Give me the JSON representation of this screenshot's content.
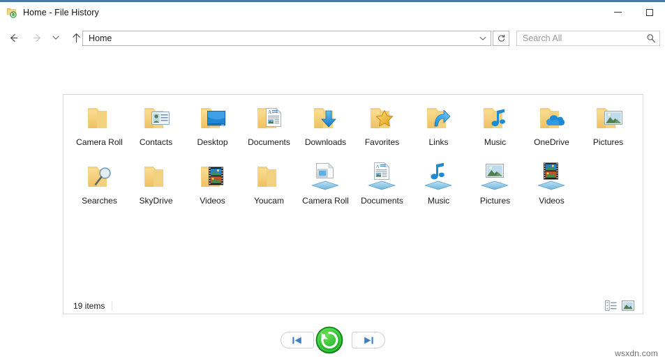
{
  "window": {
    "title": "Home - File History",
    "title_icon": "file-history-folder-icon",
    "accent_color": "#4a7aa7",
    "buttons": [
      {
        "name": "minimize-button",
        "glyph": "minimize-icon",
        "label": "Minimize"
      },
      {
        "name": "maximize-button",
        "glyph": "maximize-icon",
        "label": "Maximize"
      }
    ]
  },
  "navbar": {
    "back": {
      "icon": "arrow-left-icon",
      "label": "Back",
      "enabled": true
    },
    "forward": {
      "icon": "arrow-right-icon",
      "label": "Forward",
      "enabled": false
    },
    "recent": {
      "icon": "chevron-down-icon",
      "label": "Recent locations"
    },
    "up": {
      "icon": "arrow-up-icon",
      "label": "Up"
    },
    "address": {
      "value": "Home",
      "dropdown_icon": "chevron-down-icon"
    },
    "refresh": {
      "icon": "refresh-icon",
      "label": "Refresh"
    },
    "search": {
      "placeholder": "Search All",
      "value": "",
      "icon": "search-icon"
    }
  },
  "content": {
    "items": [
      {
        "label": "Camera Roll",
        "icon": "folder-plain-icon",
        "kind": "folder"
      },
      {
        "label": "Contacts",
        "icon": "folder-contacts-icon",
        "kind": "folder"
      },
      {
        "label": "Desktop",
        "icon": "folder-desktop-icon",
        "kind": "folder"
      },
      {
        "label": "Documents",
        "icon": "folder-documents-icon",
        "kind": "folder"
      },
      {
        "label": "Downloads",
        "icon": "folder-downloads-icon",
        "kind": "folder"
      },
      {
        "label": "Favorites",
        "icon": "folder-favorites-icon",
        "kind": "folder"
      },
      {
        "label": "Links",
        "icon": "folder-links-icon",
        "kind": "folder"
      },
      {
        "label": "Music",
        "icon": "folder-music-icon",
        "kind": "folder"
      },
      {
        "label": "OneDrive",
        "icon": "folder-onedrive-icon",
        "kind": "folder"
      },
      {
        "label": "Pictures",
        "icon": "folder-pictures-icon",
        "kind": "folder"
      },
      {
        "label": "Searches",
        "icon": "folder-searches-icon",
        "kind": "folder"
      },
      {
        "label": "SkyDrive",
        "icon": "folder-plain-icon",
        "kind": "folder"
      },
      {
        "label": "Videos",
        "icon": "folder-videos-icon",
        "kind": "folder"
      },
      {
        "label": "Youcam",
        "icon": "folder-plain-icon",
        "kind": "folder"
      },
      {
        "label": "Camera Roll",
        "icon": "library-camera-roll-icon",
        "kind": "library"
      },
      {
        "label": "Documents",
        "icon": "library-documents-icon",
        "kind": "library"
      },
      {
        "label": "Music",
        "icon": "library-music-icon",
        "kind": "library"
      },
      {
        "label": "Pictures",
        "icon": "library-pictures-icon",
        "kind": "library"
      },
      {
        "label": "Videos",
        "icon": "library-videos-icon",
        "kind": "library"
      }
    ]
  },
  "statusbar": {
    "count_text": "19 items",
    "view_buttons": [
      {
        "name": "details-view-button",
        "icon": "details-view-icon",
        "label": "Details view",
        "active": false
      },
      {
        "name": "large-icons-view-button",
        "icon": "large-icons-view-icon",
        "label": "Large icons view",
        "active": true
      }
    ]
  },
  "transport": {
    "previous": {
      "icon": "skip-previous-icon",
      "label": "Previous version"
    },
    "restore": {
      "icon": "restore-circular-arrow-icon",
      "label": "Restore to original location",
      "color": "#2fbc2f"
    },
    "next": {
      "icon": "skip-next-icon",
      "label": "Next version"
    }
  },
  "watermark": {
    "text": "wsxdn.com"
  }
}
